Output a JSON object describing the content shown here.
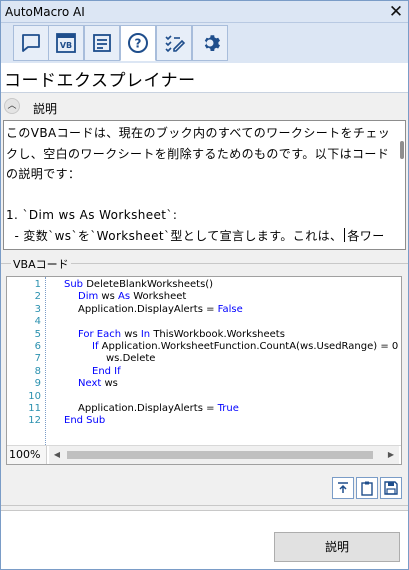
{
  "window": {
    "title": "AutoMacro AI",
    "close_icon": "close-icon"
  },
  "toolbar": {
    "buttons": [
      {
        "name": "chat-icon",
        "active": false
      },
      {
        "name": "vba-icon",
        "active": false
      },
      {
        "name": "document-list-icon",
        "active": false
      },
      {
        "name": "help-icon",
        "active": true
      },
      {
        "name": "edit-checklist-icon",
        "active": false
      },
      {
        "name": "settings-gear-icon",
        "active": false
      }
    ]
  },
  "page": {
    "title": "コードエクスプレイナー"
  },
  "explanation": {
    "section_label": "説明",
    "text": "このVBAコードは、現在のブック内のすべてのワークシートをチェックし、空白のワークシートを削除するためのものです。以下はコードの説明です：\n\n1. `Dim ws As Worksheet`:\n  - 変数`ws`を`Worksheet`型として宣言します。これは、",
    "text_after_caret": "各ワークシートを順番に参照するために使用されます。"
  },
  "vba_group": {
    "label": "VBAコード",
    "zoom": "100%",
    "lines": [
      {
        "n": "1",
        "parts": [
          [
            "kw",
            "Sub "
          ],
          [
            "t",
            "DeleteBlankWorksheets()"
          ]
        ],
        "indent": 0
      },
      {
        "n": "2",
        "parts": [
          [
            "kw",
            "Dim "
          ],
          [
            "t",
            "ws "
          ],
          [
            "kw",
            "As "
          ],
          [
            "t",
            "Worksheet"
          ]
        ],
        "indent": 1
      },
      {
        "n": "3",
        "parts": [
          [
            "t",
            "Application.DisplayAlerts = "
          ],
          [
            "kw",
            "False"
          ]
        ],
        "indent": 1
      },
      {
        "n": "4",
        "parts": [],
        "indent": 0
      },
      {
        "n": "5",
        "parts": [
          [
            "kw",
            "For Each "
          ],
          [
            "t",
            "ws "
          ],
          [
            "kw",
            "In "
          ],
          [
            "t",
            "ThisWorkbook.Worksheets"
          ]
        ],
        "indent": 1
      },
      {
        "n": "6",
        "parts": [
          [
            "kw",
            "If "
          ],
          [
            "t",
            "Application.WorksheetFunction.CountA(ws.UsedRange) = 0 "
          ],
          [
            "kw",
            "Then"
          ]
        ],
        "indent": 2
      },
      {
        "n": "7",
        "parts": [
          [
            "t",
            "ws.Delete"
          ]
        ],
        "indent": 3
      },
      {
        "n": "8",
        "parts": [
          [
            "kw",
            "End If"
          ]
        ],
        "indent": 2
      },
      {
        "n": "9",
        "parts": [
          [
            "kw",
            "Next "
          ],
          [
            "t",
            "ws"
          ]
        ],
        "indent": 1
      },
      {
        "n": "10",
        "parts": [],
        "indent": 0
      },
      {
        "n": "11",
        "parts": [
          [
            "t",
            "Application.DisplayAlerts = "
          ],
          [
            "kw",
            "True"
          ]
        ],
        "indent": 1
      },
      {
        "n": "12",
        "parts": [
          [
            "kw",
            "End Sub"
          ]
        ],
        "indent": 0
      }
    ]
  },
  "actions": {
    "insert_icon": "insert-into-editor-icon",
    "clipboard_icon": "clipboard-icon",
    "save_icon": "save-icon",
    "explain_button": "説明"
  }
}
